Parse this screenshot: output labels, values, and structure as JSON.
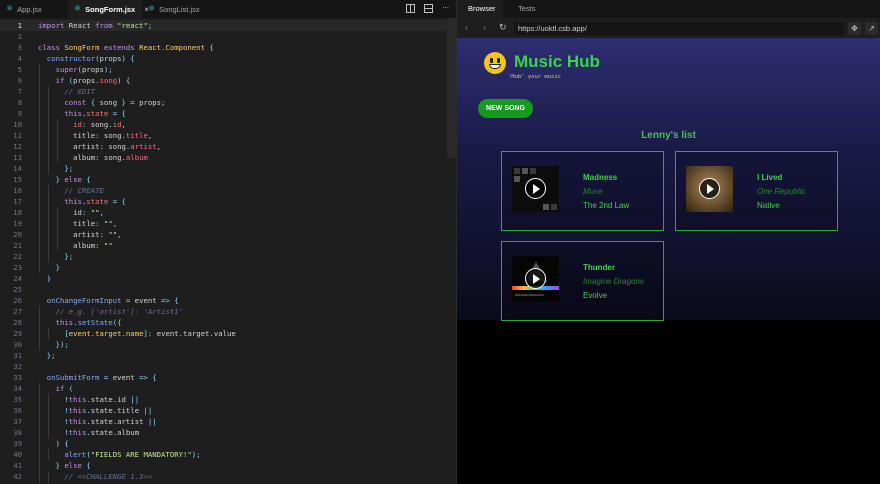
{
  "editor": {
    "tabs": [
      {
        "label": "App.jsx",
        "active": false
      },
      {
        "label": "SongForm.jsx",
        "active": true
      },
      {
        "label": "SongList.jsx",
        "active": false
      }
    ],
    "close_glyph": "×",
    "current_line": 1,
    "lines": [
      [
        [
          "kw",
          "import "
        ],
        [
          "",
          "React "
        ],
        [
          "kw",
          "from "
        ],
        [
          "str",
          "\"react\""
        ],
        [
          "pun",
          ";"
        ]
      ],
      [],
      [
        [
          "kw",
          "class "
        ],
        [
          "cls",
          "SongForm "
        ],
        [
          "kw",
          "extends "
        ],
        [
          "cls",
          "React.Component "
        ],
        [
          "pun",
          "{"
        ]
      ],
      [
        [
          "fn",
          "  constructor"
        ],
        [
          "pun",
          "("
        ],
        [
          "",
          "props"
        ],
        [
          "pun",
          ") {"
        ]
      ],
      [
        [
          "kw",
          "    super"
        ],
        [
          "pun",
          "("
        ],
        [
          "",
          "props"
        ],
        [
          "pun",
          ");"
        ]
      ],
      [
        [
          "kw",
          "    if "
        ],
        [
          "pun",
          "("
        ],
        [
          "",
          "props"
        ],
        [
          "pun",
          "."
        ],
        [
          "prop",
          "song"
        ],
        [
          "pun",
          ") {"
        ]
      ],
      [
        [
          "cmt",
          "      // EDIT"
        ]
      ],
      [
        [
          "kw",
          "      const "
        ],
        [
          "pun",
          "{ "
        ],
        [
          "",
          "song "
        ],
        [
          "pun",
          "} = "
        ],
        [
          "",
          "props"
        ],
        [
          "pun",
          ";"
        ]
      ],
      [
        [
          "kw",
          "      this"
        ],
        [
          "pun",
          "."
        ],
        [
          "prop",
          "state "
        ],
        [
          "pun",
          "= {"
        ]
      ],
      [
        [
          "prop",
          "        id"
        ],
        [
          "pun",
          ": "
        ],
        [
          "",
          "song"
        ],
        [
          "pun",
          "."
        ],
        [
          "prop",
          "id"
        ],
        [
          "pun",
          ","
        ]
      ],
      [
        [
          "",
          "        title"
        ],
        [
          "pun",
          ": "
        ],
        [
          "",
          "song"
        ],
        [
          "pun",
          "."
        ],
        [
          "prop",
          "title"
        ],
        [
          "pun",
          ","
        ]
      ],
      [
        [
          "",
          "        artist"
        ],
        [
          "pun",
          ": "
        ],
        [
          "",
          "song"
        ],
        [
          "pun",
          "."
        ],
        [
          "prop",
          "artist"
        ],
        [
          "pun",
          ","
        ]
      ],
      [
        [
          "",
          "        album"
        ],
        [
          "pun",
          ": "
        ],
        [
          "",
          "song"
        ],
        [
          "pun",
          "."
        ],
        [
          "prop",
          "album"
        ]
      ],
      [
        [
          "pun",
          "      };"
        ]
      ],
      [
        [
          "pun",
          "    } "
        ],
        [
          "kw",
          "else "
        ],
        [
          "pun",
          "{"
        ]
      ],
      [
        [
          "cmt",
          "      // CREATE"
        ]
      ],
      [
        [
          "kw",
          "      this"
        ],
        [
          "pun",
          "."
        ],
        [
          "prop",
          "state "
        ],
        [
          "pun",
          "= {"
        ]
      ],
      [
        [
          "",
          "        id"
        ],
        [
          "pun",
          ": "
        ],
        [
          "str",
          "\"\""
        ],
        [
          "pun",
          ","
        ]
      ],
      [
        [
          "",
          "        title"
        ],
        [
          "pun",
          ": "
        ],
        [
          "str",
          "\"\""
        ],
        [
          "pun",
          ","
        ]
      ],
      [
        [
          "",
          "        artist"
        ],
        [
          "pun",
          ": "
        ],
        [
          "str",
          "\"\""
        ],
        [
          "pun",
          ","
        ]
      ],
      [
        [
          "",
          "        album"
        ],
        [
          "pun",
          ": "
        ],
        [
          "str",
          "\"\""
        ]
      ],
      [
        [
          "pun",
          "      };"
        ]
      ],
      [
        [
          "pun",
          "    }"
        ]
      ],
      [
        [
          "pun",
          "  }"
        ]
      ],
      [],
      [
        [
          "fn",
          "  onChangeFormInput "
        ],
        [
          "pun",
          "= "
        ],
        [
          "",
          "event "
        ],
        [
          "pun",
          "=> {"
        ]
      ],
      [
        [
          "cmt",
          "    // e.g. ['artist']: 'Artist1'"
        ]
      ],
      [
        [
          "kw",
          "    this"
        ],
        [
          "pun",
          "."
        ],
        [
          "fn",
          "setState"
        ],
        [
          "pun",
          "({"
        ]
      ],
      [
        [
          "pun",
          "      ["
        ],
        [
          "cls",
          "event"
        ],
        [
          "pun",
          "."
        ],
        [
          "cls",
          "target"
        ],
        [
          "pun",
          "."
        ],
        [
          "cls",
          "name"
        ],
        [
          "pun",
          "]: "
        ],
        [
          "",
          "event"
        ],
        [
          "pun",
          "."
        ],
        [
          "",
          "target"
        ],
        [
          "pun",
          "."
        ],
        [
          "",
          "value"
        ]
      ],
      [
        [
          "pun",
          "    });"
        ]
      ],
      [
        [
          "pun",
          "  };"
        ]
      ],
      [],
      [
        [
          "fn",
          "  onSubmitForm "
        ],
        [
          "pun",
          "= "
        ],
        [
          "",
          "event "
        ],
        [
          "pun",
          "=> {"
        ]
      ],
      [
        [
          "kw",
          "    if "
        ],
        [
          "pun",
          "("
        ]
      ],
      [
        [
          "pun",
          "      !"
        ],
        [
          "kw",
          "this"
        ],
        [
          "pun",
          "."
        ],
        [
          "",
          "state"
        ],
        [
          "pun",
          "."
        ],
        [
          "",
          "id "
        ],
        [
          "pun",
          "||"
        ]
      ],
      [
        [
          "pun",
          "      !"
        ],
        [
          "kw",
          "this"
        ],
        [
          "pun",
          "."
        ],
        [
          "",
          "state"
        ],
        [
          "pun",
          "."
        ],
        [
          "",
          "title "
        ],
        [
          "pun",
          "||"
        ]
      ],
      [
        [
          "pun",
          "      !"
        ],
        [
          "kw",
          "this"
        ],
        [
          "pun",
          "."
        ],
        [
          "",
          "state"
        ],
        [
          "pun",
          "."
        ],
        [
          "",
          "artist "
        ],
        [
          "pun",
          "||"
        ]
      ],
      [
        [
          "pun",
          "      !"
        ],
        [
          "kw",
          "this"
        ],
        [
          "pun",
          "."
        ],
        [
          "",
          "state"
        ],
        [
          "pun",
          "."
        ],
        [
          "",
          "album"
        ]
      ],
      [
        [
          "pun",
          "    ) {"
        ]
      ],
      [
        [
          "fn",
          "      alert"
        ],
        [
          "pun",
          "("
        ],
        [
          "str",
          "\"FIELDS ARE MANDATORY!\""
        ],
        [
          "pun",
          ");"
        ]
      ],
      [
        [
          "pun",
          "    } "
        ],
        [
          "kw",
          "else "
        ],
        [
          "pun",
          "{"
        ]
      ],
      [
        [
          "cmt",
          "      // <<CHALLENGE 1.3>>"
        ]
      ]
    ]
  },
  "browser": {
    "tabs": [
      {
        "label": "Browser",
        "active": true
      },
      {
        "label": "Tests",
        "active": false
      }
    ],
    "url": "https://uoktl.csb.app/",
    "icons": {
      "back": "back-arrow-icon",
      "forward": "forward-arrow-icon",
      "reload": "reload-icon"
    }
  },
  "app": {
    "title": "Music Hub",
    "tagline": "'Hub' your music",
    "new_song_label": "NEW SONG",
    "list_title": "Lenny's list",
    "songs": [
      {
        "title": "Madness",
        "artist": "Muse",
        "album": "The 2nd Law"
      },
      {
        "title": "I Lived",
        "artist": "One Republic",
        "album": "Native"
      },
      {
        "title": "Thunder",
        "artist": "Imagine Dragons",
        "album": "Evolve",
        "cover_label": "IMAGINE DRAGONS"
      }
    ]
  },
  "colors": {
    "accent_green": "#3ad24a",
    "button_green": "#169a1e",
    "editor_bg": "#1e1e1e"
  }
}
